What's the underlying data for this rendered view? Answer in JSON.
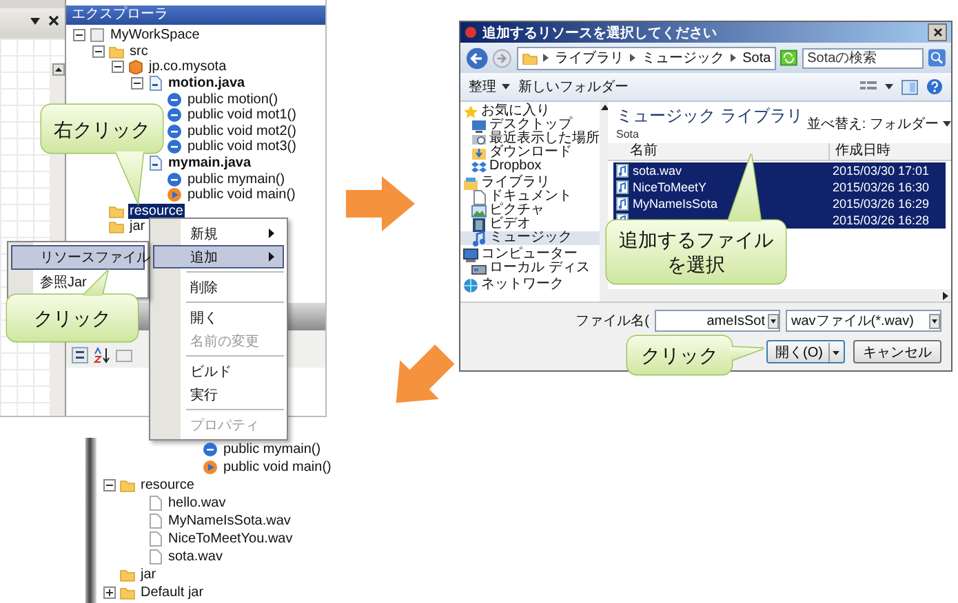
{
  "explorer": {
    "title": "エクスプローラ",
    "tree": [
      {
        "label": "MyWorkSpace",
        "kind": "workspace",
        "expanded": true,
        "selected": false,
        "children": [
          {
            "label": "src",
            "kind": "folder",
            "expanded": true,
            "selected": false,
            "children": [
              {
                "label": "jp.co.mysota",
                "kind": "package",
                "expanded": true,
                "selected": false,
                "children": [
                  {
                    "label": "motion.java",
                    "kind": "java",
                    "expanded": true,
                    "selected": false,
                    "children": [
                      {
                        "label": "public motion()",
                        "kind": "method",
                        "selected": false
                      },
                      {
                        "label": "public void mot1()",
                        "kind": "method",
                        "selected": false
                      },
                      {
                        "label": "public void mot2()",
                        "kind": "method",
                        "selected": false
                      },
                      {
                        "label": "public void mot3()",
                        "kind": "method",
                        "selected": false
                      }
                    ]
                  },
                  {
                    "label": "mymain.java",
                    "kind": "java",
                    "selected": false,
                    "children": [
                      {
                        "label": "public mymain()",
                        "kind": "method",
                        "selected": false
                      },
                      {
                        "label": "public void main()",
                        "kind": "main",
                        "selected": false
                      }
                    ]
                  }
                ]
              }
            ]
          },
          {
            "label": "resource",
            "kind": "folder",
            "selected": true
          },
          {
            "label": "jar",
            "kind": "folder",
            "selected": false
          }
        ]
      }
    ]
  },
  "context_menu": {
    "items": [
      {
        "kind": "item",
        "label": "新規",
        "submenu": true,
        "selected": false,
        "disabled": false
      },
      {
        "kind": "item",
        "label": "追加",
        "submenu": true,
        "selected": true,
        "disabled": false
      },
      {
        "kind": "separator"
      },
      {
        "kind": "item",
        "label": "削除",
        "submenu": false,
        "selected": false,
        "disabled": false
      },
      {
        "kind": "separator"
      },
      {
        "kind": "item",
        "label": "開く",
        "submenu": false,
        "selected": false,
        "disabled": false
      },
      {
        "kind": "item",
        "label": "名前の変更",
        "submenu": false,
        "selected": false,
        "disabled": true
      },
      {
        "kind": "separator"
      },
      {
        "kind": "item",
        "label": "ビルド",
        "submenu": false,
        "selected": false,
        "disabled": false
      },
      {
        "kind": "item",
        "label": "実行",
        "submenu": false,
        "selected": false,
        "disabled": false
      },
      {
        "kind": "separator"
      },
      {
        "kind": "item",
        "label": "プロパティ",
        "submenu": false,
        "selected": false,
        "disabled": true
      }
    ]
  },
  "submenu": {
    "items": [
      {
        "label": "リソースファイル",
        "selected": true
      },
      {
        "label": "参照Jar",
        "selected": false
      }
    ]
  },
  "callouts": [
    {
      "text": "右クリック"
    },
    {
      "text": "クリック"
    },
    {
      "text": "追加するファイルを選択"
    },
    {
      "text": "クリック"
    }
  ],
  "dialog": {
    "title": "追加するリソースを選択してください",
    "breadcrumb": [
      "ライブラリ",
      "ミュージック",
      "Sota"
    ],
    "search": {
      "placeholder": "Sotaの検索"
    },
    "toolbar": [
      {
        "label": "整理",
        "dropdown": true
      },
      {
        "label": "新しいフォルダー",
        "dropdown": false
      }
    ],
    "nav": [
      {
        "label": "お気に入り",
        "kind": "favorites",
        "selected": false
      },
      {
        "label": "デスクトップ",
        "kind": "desktop",
        "selected": false
      },
      {
        "label": "最近表示した場所",
        "kind": "recent",
        "selected": false
      },
      {
        "label": "ダウンロード",
        "kind": "download",
        "selected": false
      },
      {
        "label": "Dropbox",
        "kind": "dropbox",
        "selected": false
      },
      {
        "label": "ライブラリ",
        "kind": "library",
        "selected": false
      },
      {
        "label": "ドキュメント",
        "kind": "document",
        "selected": false
      },
      {
        "label": "ピクチャ",
        "kind": "picture",
        "selected": false
      },
      {
        "label": "ビデオ",
        "kind": "video",
        "selected": false
      },
      {
        "label": "ミュージック",
        "kind": "music",
        "selected": true
      },
      {
        "label": "コンピューター",
        "kind": "computer",
        "selected": false
      },
      {
        "label": "ローカル ディス",
        "kind": "disk",
        "selected": false
      },
      {
        "label": "ネットワーク",
        "kind": "network",
        "selected": false
      }
    ],
    "library_title": "ミュージック ライブラリ",
    "library_sub": "Sota",
    "sort_label": "並べ替え:",
    "sort_value": "フォルダー",
    "columns": [
      "名前",
      "作成日時"
    ],
    "files": [
      {
        "name": "sota.wav",
        "date": "2015/03/30 17:01",
        "selected": true
      },
      {
        "name": "NiceToMeetY",
        "date": "2015/03/26 16:30",
        "selected": true
      },
      {
        "name": "MyNameIsSota",
        "date": "2015/03/26 16:29",
        "selected": true
      },
      {
        "date": "2015/03/26 16:28",
        "selected": true
      }
    ],
    "filename_label": "ファイル名(",
    "filename_value": "ameIsSot",
    "filetype": "wavファイル(*.wav)",
    "buttons": [
      {
        "label": "開く(O)",
        "kind": "split"
      },
      {
        "label": "キャンセル",
        "kind": "plain"
      }
    ]
  },
  "result_tree": [
    {
      "children": [
        {
          "children": [
            {
              "children": [
                {
                  "label": "public mymain()",
                  "kind": "method"
                },
                {
                  "label": "public void main()",
                  "kind": "main"
                }
              ]
            }
          ]
        }
      ]
    },
    {
      "label": "resource",
      "kind": "folder",
      "expanded": true,
      "children": [
        {
          "label": "hello.wav",
          "kind": "wav"
        },
        {
          "label": "MyNameIsSota.wav",
          "kind": "wav"
        },
        {
          "label": "NiceToMeetYou.wav",
          "kind": "wav"
        },
        {
          "label": "sota.wav",
          "kind": "wav"
        }
      ]
    },
    {
      "label": "jar",
      "kind": "folder"
    },
    {
      "label": "Default jar",
      "kind": "folder",
      "expanded": false
    }
  ]
}
